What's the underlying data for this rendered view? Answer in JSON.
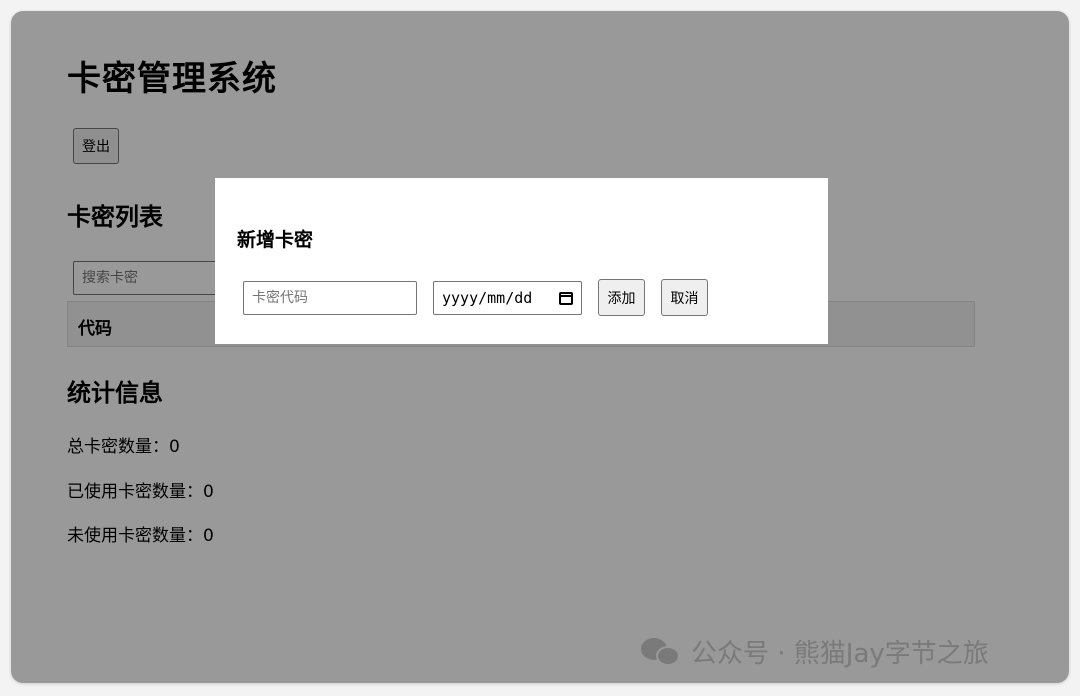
{
  "page": {
    "title": "卡密管理系统",
    "logout_label": "登出",
    "list_title": "卡密列表",
    "search_placeholder": "搜索卡密",
    "table_headers": [
      "代码"
    ],
    "stats_title": "统计信息",
    "stats": {
      "total_label": "总卡密数量：0",
      "used_label": "已使用卡密数量：0",
      "unused_label": "未使用卡密数量：0"
    }
  },
  "modal": {
    "title": "新增卡密",
    "code_placeholder": "卡密代码",
    "date_placeholder": "yyyy/mm/dd",
    "add_label": "添加",
    "cancel_label": "取消"
  },
  "watermark": {
    "text": "公众号 · 熊猫Jay字节之旅",
    "icon": "wechat-icon"
  },
  "colors": {
    "overlay": "#000000",
    "modal_background": "#ffffff",
    "table_header_background": "#f2f2f2"
  }
}
